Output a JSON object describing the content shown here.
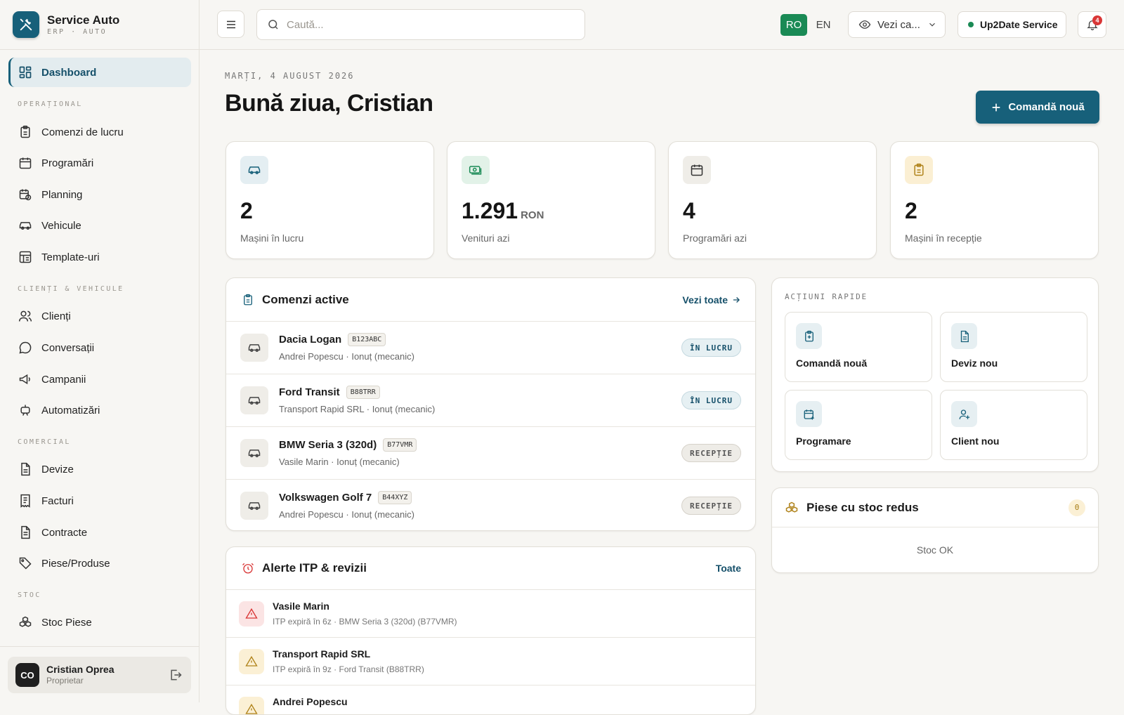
{
  "brand": {
    "name": "Service Auto",
    "subtitle": "ERP · AUTO"
  },
  "nav": {
    "dashboard": "Dashboard",
    "sec_operational": "OPERAȚIONAL",
    "work_orders": "Comenzi de lucru",
    "appointments": "Programări",
    "planning": "Planning",
    "vehicles": "Vehicule",
    "templates": "Template-uri",
    "sec_clients": "CLIENȚI & VEHICULE",
    "clients": "Clienți",
    "conversations": "Conversații",
    "campaigns": "Campanii",
    "automations": "Automatizări",
    "sec_commercial": "COMERCIAL",
    "quotes": "Devize",
    "invoices": "Facturi",
    "contracts": "Contracte",
    "parts": "Piese/Produse",
    "sec_stock": "STOC",
    "stock_parts": "Stoc Piese"
  },
  "user": {
    "initials": "CO",
    "name": "Cristian Oprea",
    "role": "Proprietar"
  },
  "topbar": {
    "search_placeholder": "Caută...",
    "lang_ro": "RO",
    "lang_en": "EN",
    "view_label": "Vezi ca...",
    "org_name": "Up2Date Service",
    "notif_count": "4"
  },
  "header": {
    "date": "MARȚI, 4 AUGUST 2026",
    "greeting": "Bună ziua, Cristian",
    "new_order": "Comandă nouă"
  },
  "stats": [
    {
      "value": "2",
      "unit": "",
      "label": "Mașini în lucru"
    },
    {
      "value": "1.291",
      "unit": "RON",
      "label": "Venituri azi"
    },
    {
      "value": "4",
      "unit": "",
      "label": "Programări azi"
    },
    {
      "value": "2",
      "unit": "",
      "label": "Mașini în recepție"
    }
  ],
  "active_orders": {
    "title": "Comenzi active",
    "link": "Vezi toate",
    "rows": [
      {
        "car": "Dacia Logan",
        "plate": "B123ABC",
        "sub": "Andrei Popescu · Ionuț (mecanic)",
        "status": "ÎN LUCRU"
      },
      {
        "car": "Ford Transit",
        "plate": "B88TRR",
        "sub": "Transport Rapid SRL · Ionuț (mecanic)",
        "status": "ÎN LUCRU"
      },
      {
        "car": "BMW Seria 3 (320d)",
        "plate": "B77VMR",
        "sub": "Vasile Marin · Ionuț (mecanic)",
        "status": "RECEPȚIE"
      },
      {
        "car": "Volkswagen Golf 7",
        "plate": "B44XYZ",
        "sub": "Andrei Popescu · Ionuț (mecanic)",
        "status": "RECEPȚIE"
      }
    ]
  },
  "alerts": {
    "title": "Alerte ITP & revizii",
    "link": "Toate",
    "rows": [
      {
        "name": "Vasile Marin",
        "sub": "ITP expiră în 6z · BMW Seria 3 (320d) (B77VMR)"
      },
      {
        "name": "Transport Rapid SRL",
        "sub": "ITP expiră în 9z · Ford Transit (B88TRR)"
      },
      {
        "name": "Andrei Popescu",
        "sub": ""
      }
    ]
  },
  "quick_actions": {
    "title": "ACȚIUNI RAPIDE",
    "items": [
      "Comandă nouă",
      "Deviz nou",
      "Programare",
      "Client nou"
    ]
  },
  "low_stock": {
    "title": "Piese cu stoc redus",
    "count": "0",
    "empty": "Stoc OK"
  },
  "colors": {
    "accent": "#17607a",
    "success": "#1a8a55",
    "danger": "#d93636",
    "warning": "#c99a1e"
  }
}
